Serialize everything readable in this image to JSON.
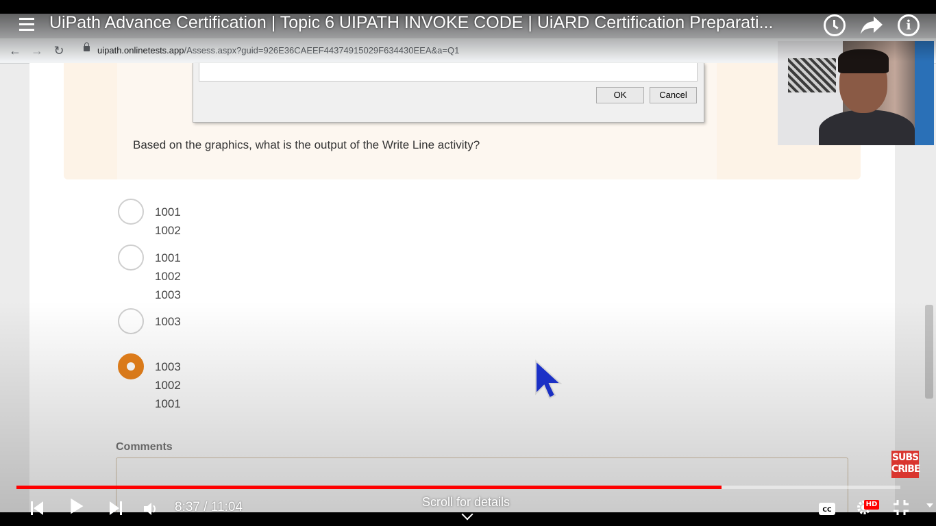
{
  "video": {
    "title": "UiPath Advance Certification | Topic 6 UIPATH INVOKE CODE | UiARD Certification Preparati...",
    "time_display": "8:37 / 11:04",
    "progress_fraction": 0.798,
    "scroll_hint": "Scroll for details",
    "hd_badge": "HD",
    "subscribe_label_1": "SUBS",
    "subscribe_label_2": "CRIBE",
    "info_symbol": "i",
    "progress_color": "#ff0000"
  },
  "browser": {
    "url_host": "uipath.onlinetests.app",
    "url_path": "/Assess.aspx?guid=926E36CAEEF44374915029F634430EEA&a=Q1"
  },
  "dialog": {
    "ok_label": "OK",
    "cancel_label": "Cancel"
  },
  "question": {
    "text": "Based on the graphics, what is the output of the Write Line activity?"
  },
  "options": [
    {
      "lines": [
        "1001",
        "1002"
      ],
      "selected": false
    },
    {
      "lines": [
        "1001",
        "1002",
        "1003"
      ],
      "selected": false
    },
    {
      "lines": [
        "1003"
      ],
      "selected": false
    },
    {
      "lines": [
        "1003",
        "1002",
        "1001"
      ],
      "selected": true
    }
  ],
  "comments": {
    "label": "Comments"
  },
  "colors": {
    "selected_radio": "#e8821c",
    "question_bg": "#fdf3e7"
  }
}
